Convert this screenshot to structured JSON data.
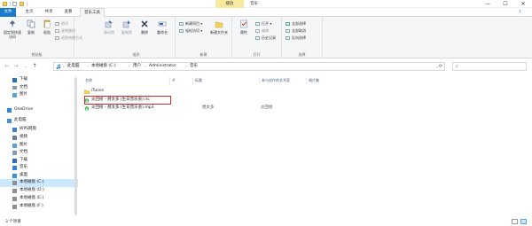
{
  "titlebar": {
    "contextual_label": "播放",
    "window_title": "音乐",
    "minimize": "—",
    "maximize": "☐",
    "close": "✕"
  },
  "tabs": [
    "文件",
    "主页",
    "共享",
    "查看",
    "音乐工具"
  ],
  "ribbon": {
    "clipboard": {
      "group_label": "剪贴板",
      "pin_label": "固定到快速访问",
      "copy_label": "复制",
      "paste_label": "粘贴",
      "cut_label": "剪切",
      "copy_path_label": "复制路径",
      "paste_shortcut_label": "粘贴快捷方式"
    },
    "organize": {
      "group_label": "组织",
      "move_to_label": "移动到",
      "copy_to_label": "复制到",
      "delete_label": "删除",
      "rename_label": "重命名"
    },
    "new": {
      "group_label": "新建",
      "new_folder_label": "新建文件夹",
      "new_item_label": "新建项目 ▾",
      "easy_access_label": "轻松访问 ▾"
    },
    "open": {
      "group_label": "打开",
      "properties_label": "属性",
      "open_label": "打开 ▾",
      "edit_label": "编辑",
      "history_label": "历史记录"
    },
    "select": {
      "group_label": "选择",
      "select_all_label": "全部选择",
      "select_none_label": "全部取消",
      "invert_label": "反向选择"
    }
  },
  "address": {
    "crumbs": [
      "此电脑",
      "本地磁盘 (C:)",
      "用户",
      "Administrator",
      "音乐"
    ],
    "search_placeholder": ""
  },
  "nav": {
    "items": [
      {
        "label": "下载",
        "icon": "download-icon",
        "level": 1
      },
      {
        "label": "文档",
        "icon": "document-icon",
        "level": 1
      },
      {
        "label": "图片",
        "icon": "picture-icon",
        "level": 1
      },
      {
        "label": "OneDrive",
        "icon": "cloud-icon",
        "level": 0
      },
      {
        "label": "此电脑",
        "icon": "computer-icon",
        "level": 0
      },
      {
        "label": "WPS网盘",
        "icon": "wps-cloud-icon",
        "level": 1
      },
      {
        "label": "视频",
        "icon": "video-icon",
        "level": 1
      },
      {
        "label": "图片",
        "icon": "picture-icon",
        "level": 1
      },
      {
        "label": "文档",
        "icon": "document-icon",
        "level": 1
      },
      {
        "label": "下载",
        "icon": "download-icon",
        "level": 1
      },
      {
        "label": "音乐",
        "icon": "music-icon",
        "level": 1
      },
      {
        "label": "桌面",
        "icon": "desktop-icon",
        "level": 1
      },
      {
        "label": "本地磁盘 (C:)",
        "icon": "drive-icon",
        "level": 1,
        "selected": true
      },
      {
        "label": "本地磁盘 (D:)",
        "icon": "drive-icon",
        "level": 1
      },
      {
        "label": "本地磁盘 (E:)",
        "icon": "drive-icon",
        "level": 1
      },
      {
        "label": "本地磁盘 (F:)",
        "icon": "drive-icon",
        "level": 1
      }
    ]
  },
  "columns": [
    "名称",
    "#",
    "标题",
    "参与创作的艺术家",
    "唱片集"
  ],
  "files": [
    {
      "name": "iTunes",
      "type": "folder",
      "number": "",
      "title": "",
      "artist": "",
      "album": ""
    },
    {
      "name": "炎回桧 - 想太多 (生日晋乐会).lrc",
      "type": "lyrics",
      "number": "",
      "title": "",
      "artist": "",
      "album": ""
    },
    {
      "name": "炎回桧 - 想太多 (生日晋乐会).mp3",
      "type": "audio",
      "number": "",
      "title": "想太多",
      "artist": "炎回桧",
      "album": ""
    }
  ],
  "status": {
    "count_text": "3 个项目"
  },
  "colors": {
    "file_tab": "#1979ca",
    "contextual_tab": "#f7e99e",
    "selection": "#cce8ff",
    "highlight_box": "#d32a2a",
    "folder": "#f3cf55"
  }
}
